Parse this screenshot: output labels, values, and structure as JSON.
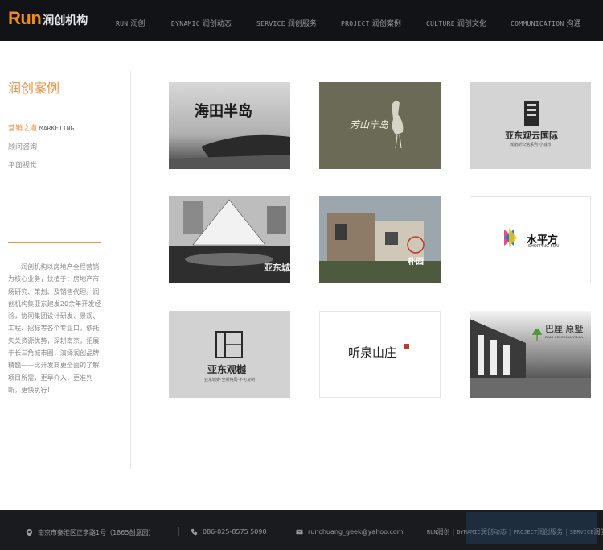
{
  "header": {
    "logo_run": "Run",
    "logo_cn": "润创机构",
    "nav": [
      {
        "en": "RUN",
        "zh": "润创"
      },
      {
        "en": "DYNAMIC",
        "zh": "润创动态"
      },
      {
        "en": "SERVICE",
        "zh": "润创服务"
      },
      {
        "en": "PROJECT",
        "zh": "润创案例"
      },
      {
        "en": "CULTURE",
        "zh": "润创文化"
      },
      {
        "en": "COMMUNICATION",
        "zh": "沟通"
      }
    ]
  },
  "sidebar": {
    "title": "润创案例",
    "menu": [
      {
        "zh": "营销之道",
        "en": "MARKETING"
      },
      {
        "zh": "顾问咨询",
        "en": ""
      },
      {
        "zh": "平面视觉",
        "en": ""
      }
    ],
    "description": "润创机构以房地产全程营销为核心业务，扶植于：房地产市场研究、策划、及销售代理。润创机构集亚东建发20余年开发经验，协同集团设计研发、景观、工程、招标等各个专业口，依托失关资源优势，深耕南京，拓展于长三角城市圈，演绎润创品牌精髓——比开发商更全面的了解项目所需，更早介入，更准判断，更快执行！"
  },
  "projects": [
    {
      "name": "海田半岛"
    },
    {
      "name": "芳山丰岛"
    },
    {
      "name": "亚东观云国际",
      "sub": "城南新公馆系列 小城市"
    },
    {
      "name": "亚东城"
    },
    {
      "name": "朴园"
    },
    {
      "name": "水平方",
      "sub": "SHOPPING FUN"
    },
    {
      "name": "亚东观樾",
      "sub": "亚东城旁·全新格局·不可复制"
    },
    {
      "name": "听泉山庄"
    },
    {
      "name": "巴厘·原墅",
      "sub": "BALI ORIGINAL VILLA"
    }
  ],
  "footer": {
    "address": "南京市秦淮区正学路1号（1865创意园）",
    "phone": "086-025-8575 5090",
    "email": "runchuang_geek@yahoo.com",
    "links": [
      {
        "en": "RUN",
        "zh": "润创"
      },
      {
        "en": "DYNAMIC",
        "zh": "润创动态"
      },
      {
        "en": "PROJECT",
        "zh": "润创服务"
      },
      {
        "en": "SERVICE",
        "zh": "润创"
      }
    ]
  },
  "colors": {
    "accent": "#e8944a",
    "header_bg": "#111316",
    "footer_bg": "#1a1b1e"
  }
}
